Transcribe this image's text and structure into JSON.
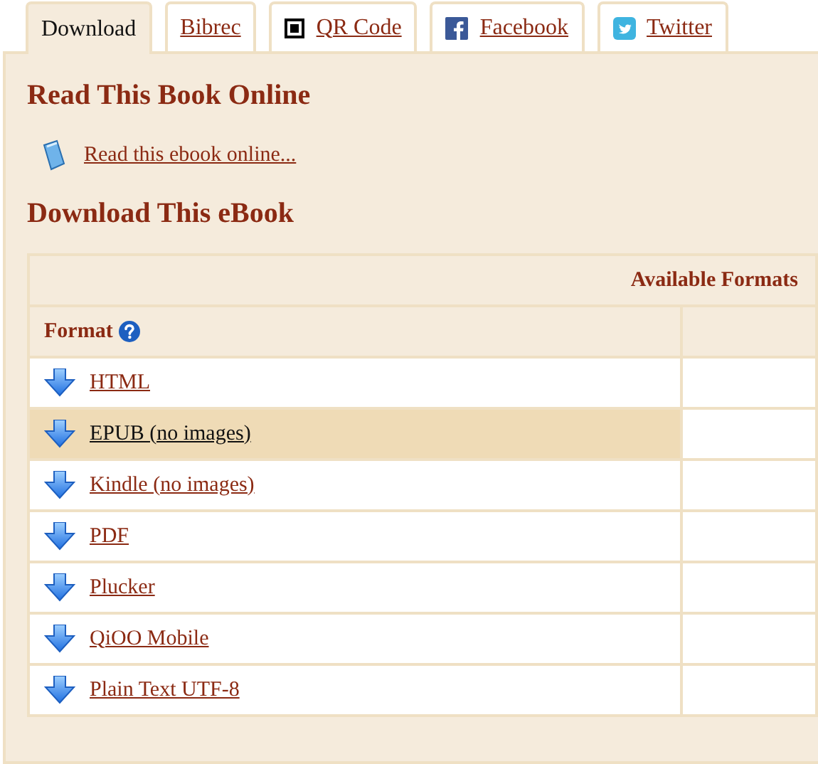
{
  "tabs": [
    {
      "label": "Download",
      "kind": "plain",
      "selected": true
    },
    {
      "label": "Bibrec",
      "kind": "plain",
      "selected": false
    },
    {
      "label": "QR Code",
      "kind": "qr",
      "selected": false
    },
    {
      "label": "Facebook",
      "kind": "facebook",
      "selected": false
    },
    {
      "label": "Twitter",
      "kind": "twitter",
      "selected": false
    }
  ],
  "read_section": {
    "heading": "Read This Book Online",
    "link": "Read this ebook online..."
  },
  "download_section": {
    "heading": "Download This eBook",
    "table": {
      "group_header": "Available Formats",
      "column_header": "Format",
      "rows": [
        {
          "format": "HTML",
          "highlighted": false
        },
        {
          "format": "EPUB (no images)",
          "highlighted": true
        },
        {
          "format": "Kindle (no images)",
          "highlighted": false
        },
        {
          "format": "PDF",
          "highlighted": false
        },
        {
          "format": "Plucker",
          "highlighted": false
        },
        {
          "format": "QiOO Mobile",
          "highlighted": false
        },
        {
          "format": "Plain Text UTF-8",
          "highlighted": false
        }
      ]
    }
  }
}
